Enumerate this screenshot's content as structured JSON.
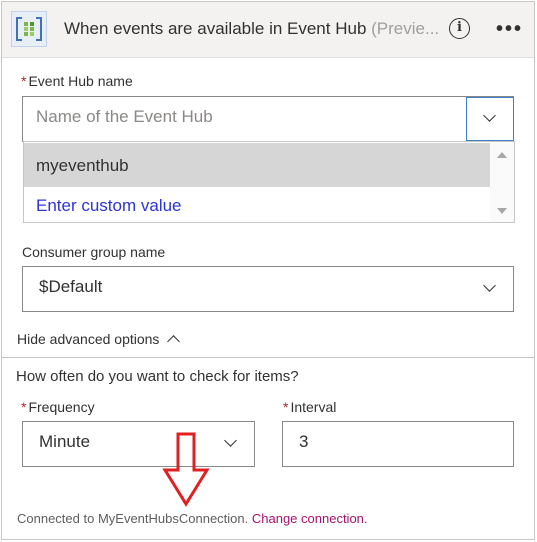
{
  "header": {
    "title": "When events are available in Event Hub",
    "preview": "(Previe...",
    "info_icon": "info-icon",
    "more_icon": "more-options-icon"
  },
  "event_hub": {
    "required_mark": "*",
    "label": "Event Hub name",
    "placeholder": "Name of the Event Hub",
    "options": [
      "myeventhub",
      "Enter custom value"
    ]
  },
  "consumer_group": {
    "label": "Consumer group name",
    "value": "$Default"
  },
  "advanced": {
    "toggle_label": "Hide advanced options"
  },
  "schedule": {
    "heading": "How often do you want to check for items?",
    "frequency_label": "Frequency",
    "frequency_value": "Minute",
    "interval_label": "Interval",
    "interval_value": "3",
    "required_mark": "*"
  },
  "footer": {
    "connected_text": "Connected to MyEventHubsConnection.",
    "change_link": "Change connection."
  },
  "colors": {
    "accent_link": "#a4136b",
    "custom_value": "#2c33d4",
    "required": "#a4262c",
    "annotation_arrow": "#e02020"
  }
}
